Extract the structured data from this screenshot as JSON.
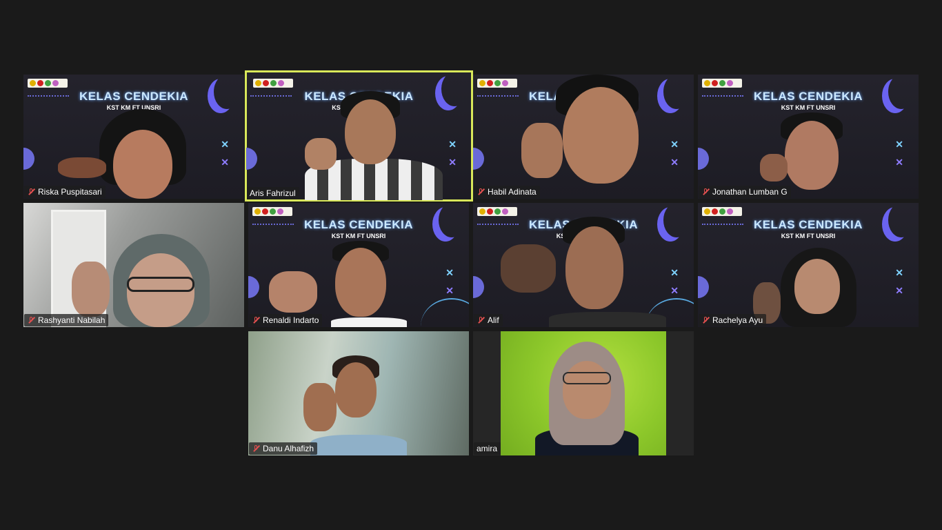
{
  "banner": {
    "title": "KELAS CENDEKIA",
    "subtitle": "KST KM FT UNSRI"
  },
  "participants": [
    {
      "name": "Riska Puspitasari",
      "muted": true
    },
    {
      "name": "Aris Fahrizul",
      "muted": false,
      "active_speaker": true
    },
    {
      "name": "Habil Adinata",
      "muted": true
    },
    {
      "name": "Jonathan Lumban G",
      "muted": true
    },
    {
      "name": "Rashyanti Nabilah",
      "muted": true
    },
    {
      "name": "Renaldi Indarto",
      "muted": true
    },
    {
      "name": "Alif",
      "muted": true
    },
    {
      "name": "Rachelya Ayu",
      "muted": true
    },
    {
      "name": "Danu Alhafizh",
      "muted": true
    },
    {
      "name": "amira",
      "muted": false
    }
  ],
  "colors": {
    "background": "#1a1a1a",
    "active_border": "#d9e85a",
    "mute": "#e25050",
    "banner_title": "#cbe8ff",
    "accent": "#6a63f0"
  },
  "icons": {
    "mute": "mic-muted-icon"
  }
}
